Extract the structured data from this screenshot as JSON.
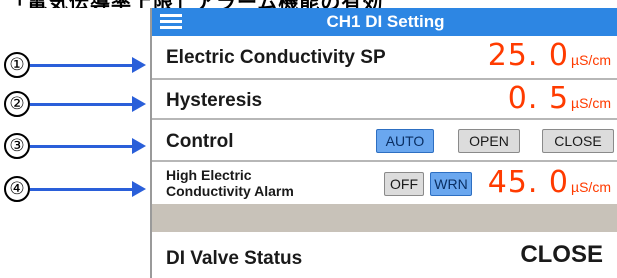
{
  "top_caption": "「電気伝導率上限」アラーム機能の有効",
  "callouts": [
    "①",
    "②",
    "③",
    "④"
  ],
  "header": {
    "menu_icon": "hamburger-menu-icon",
    "title": "CH1 DI Setting"
  },
  "rows": {
    "ec_sp": {
      "label": "Electric Conductivity SP",
      "value": "25. 0",
      "unit": "µS/cm"
    },
    "hysteresis": {
      "label": "Hysteresis",
      "value": "0. 5",
      "unit": "µS/cm"
    },
    "control": {
      "label": "Control",
      "buttons": [
        "AUTO",
        "OPEN",
        "CLOSE"
      ],
      "selected": "AUTO"
    },
    "alarm": {
      "label_line1": "High Electric",
      "label_line2": "Conductivity Alarm",
      "buttons": [
        "OFF",
        "WRN"
      ],
      "selected": "WRN",
      "value": "45. 0",
      "unit": "µS/cm"
    }
  },
  "status": {
    "label": "DI Valve Status",
    "value": "CLOSE"
  },
  "colors": {
    "title_bar": "#2d86e3",
    "value_text": "#ff3b00",
    "active_button": "#6aa7ef",
    "arrow": "#2a5fd9",
    "separator": "#c8c2b9"
  }
}
